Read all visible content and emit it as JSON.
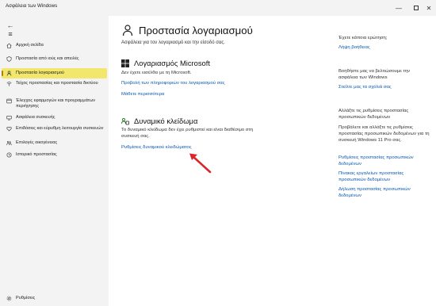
{
  "window": {
    "title": "Ασφάλεια των Windows",
    "minimize_glyph": "—",
    "close_glyph": "✕"
  },
  "sidebar": {
    "back_glyph": "←",
    "menu_glyph": "≡",
    "items": [
      {
        "label": "Αρχική σελίδα",
        "icon": "home-icon"
      },
      {
        "label": "Προστασία από ιούς και απειλές",
        "icon": "shield-icon"
      },
      {
        "label": "Προστασία λογαριασμού",
        "icon": "person-icon",
        "active": true
      },
      {
        "label": "Τείχος προστασίας και προστασία δικτύου",
        "icon": "wifi-icon"
      },
      {
        "label": "Έλεγχος εφαρμογών και προγραμμάτων περιήγησης",
        "icon": "app-browser-icon"
      },
      {
        "label": "Ασφάλεια συσκευής",
        "icon": "device-icon"
      },
      {
        "label": "Επιδόσεις και εύρυθμη λειτουργία συσκευών",
        "icon": "heart-icon"
      },
      {
        "label": "Επιλογές οικογένειας",
        "icon": "family-icon"
      },
      {
        "label": "Ιστορικό προστασίας",
        "icon": "history-icon"
      }
    ],
    "settings_label": "Ρυθμίσεις"
  },
  "main": {
    "title": "Προστασία λογαριασμού",
    "subtitle": "Ασφάλεια για τον λογαριασμό και την είσοδό σας.",
    "microsoft": {
      "heading": "Λογαριασμός Microsoft",
      "text": "Δεν έχετε εισέλθει με τη Microsoft.",
      "link1": "Προβολή των πληροφοριών του λογαριασμού σας",
      "link2": "Μάθετε περισσότερα"
    },
    "dynamic_lock": {
      "heading": "Δυναμικό κλείδωμα",
      "text_line1": "Το δυναμικό κλείδωμα δεν έχει ρυθμιστεί και είναι διαθέσιμο στη",
      "text_line2": "συσκευή σας.",
      "link": "Ρυθμίσεις δυναμικού κλειδώματος"
    }
  },
  "right": {
    "q_heading": "Έχετε κάποια ερώτηση;",
    "q_link": "Λήψη βοήθειας",
    "improve_line1": "Βοηθήστε μας να βελτιώσουμε την",
    "improve_line2": "ασφάλεια των Windows",
    "improve_link": "Στείλτε μας τα σχόλιά σας",
    "privacy_heading_1": "Αλλάξτε τις ρυθμίσεις προστασίας",
    "privacy_heading_2": "προσωπικών δεδομένων",
    "privacy_text_1": "Προβάλετε και αλλάξτε τις ρυθμίσεις",
    "privacy_text_2": "προστασίας προσωπικών δεδομένων για τη",
    "privacy_text_3": "συσκευή Windows 11 Pro σας.",
    "privacy_link1_1": "Ρυθμίσεις προστασίας προσωπικών",
    "privacy_link1_2": "δεδομένων",
    "privacy_link2_1": "Πίνακας εργαλείων προστασίας",
    "privacy_link2_2": "προσωπικών δεδομένων",
    "privacy_link3_1": "Δήλωση προστασίας προσωπικών",
    "privacy_link3_2": "δεδομένων"
  },
  "colors": {
    "active_bg": "#f2e66d",
    "link": "#0a58b4",
    "annotation_arrow": "#d9262b"
  }
}
